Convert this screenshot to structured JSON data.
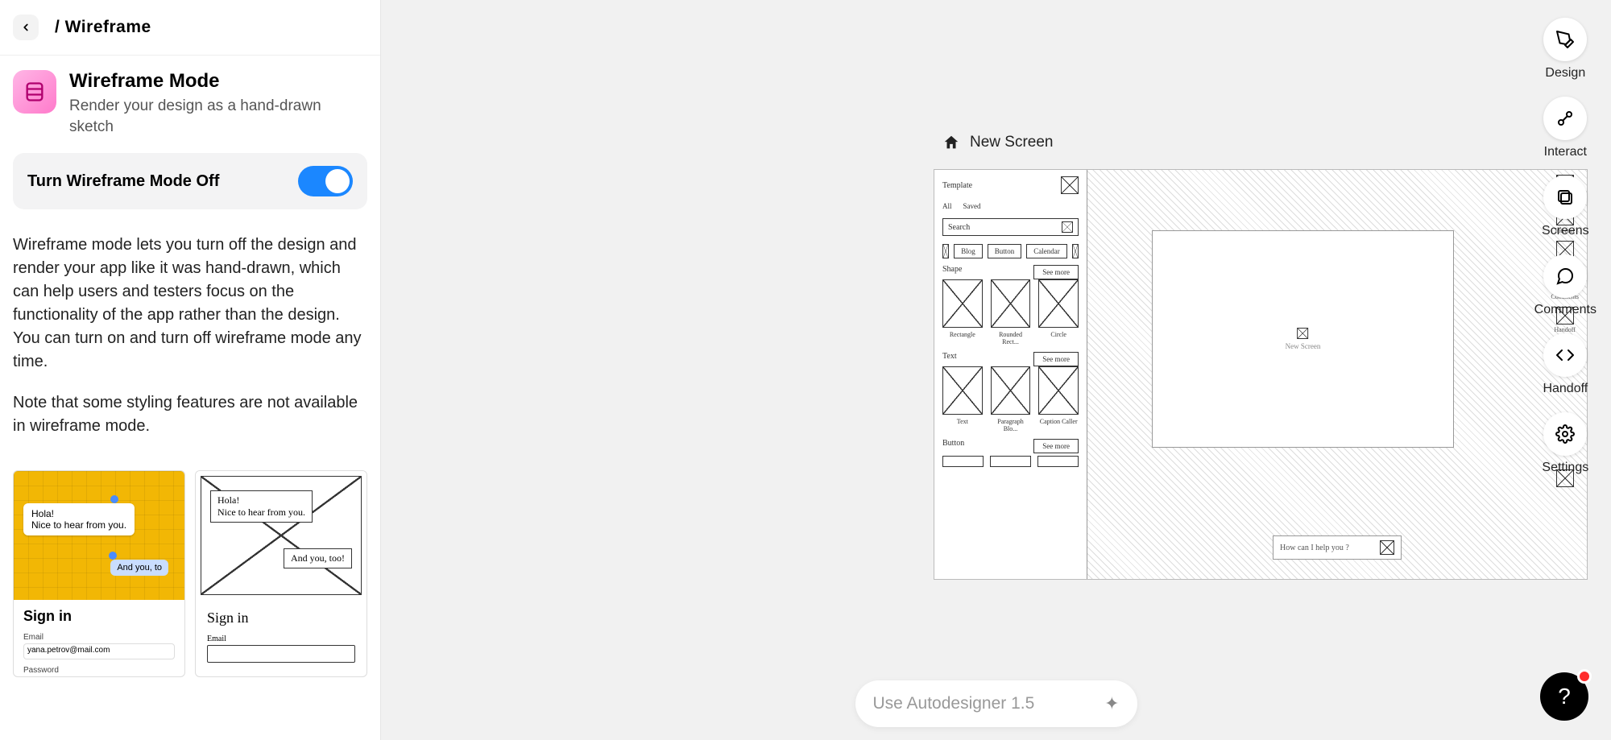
{
  "breadcrumb": {
    "prefix": "/ ",
    "page": "Wireframe"
  },
  "mode": {
    "title": "Wireframe Mode",
    "subtitle": "Render your design as a hand-drawn sketch"
  },
  "toggle": {
    "label": "Turn Wireframe Mode Off",
    "on": true
  },
  "description": "Wireframe mode lets you turn off the design and render your app like it was hand-drawn, which can help users and testers focus on the functionality of the app rather than the design.\nYou can turn on and turn off wireframe mode any time.",
  "note": "Note that some styling features are not available in wireframe mode.",
  "preview": {
    "designed": {
      "bubble1_line1": "Hola!",
      "bubble1_line2": "Nice to hear from you.",
      "bubble2": "And you, to",
      "signin_title": "Sign in",
      "email_label": "Email",
      "email_value": "yana.petrov@mail.com",
      "password_label": "Password"
    },
    "sketch": {
      "bubble1_line1": "Hola!",
      "bubble1_line2": "Nice to hear from you.",
      "bubble2": "And you, too!",
      "signin_title": "Sign in",
      "email_label": "Email"
    }
  },
  "canvas": {
    "screen_name": "New Screen",
    "left_panel": {
      "title": "Template",
      "tab_all": "All",
      "tab_saved": "Saved",
      "search": "Search",
      "chips": [
        "Blog",
        "Button",
        "Calendar"
      ],
      "section_shape": "Shape",
      "see_more": "See more",
      "shape_captions": [
        "Rectangle",
        "Rounded Rect...",
        "Circle"
      ],
      "section_text": "Text",
      "text_captions": [
        "Text",
        "Paragraph Blo...",
        "Caption Caller"
      ],
      "section_button": "Button"
    },
    "center_placeholder": "New Screen",
    "prompt_placeholder": "How can I help you ?",
    "right_items": [
      "Design",
      "Interact",
      "Screens",
      "Comments",
      "Handoff",
      "Settings"
    ]
  },
  "autodesigner": {
    "label": "Use Autodesigner 1.5"
  },
  "tools": [
    {
      "id": "design",
      "label": "Design"
    },
    {
      "id": "interact",
      "label": "Interact"
    },
    {
      "id": "screens",
      "label": "Screens"
    },
    {
      "id": "comments",
      "label": "Comments"
    },
    {
      "id": "handoff",
      "label": "Handoff"
    },
    {
      "id": "settings",
      "label": "Settings"
    }
  ],
  "help": {
    "glyph": "?"
  }
}
